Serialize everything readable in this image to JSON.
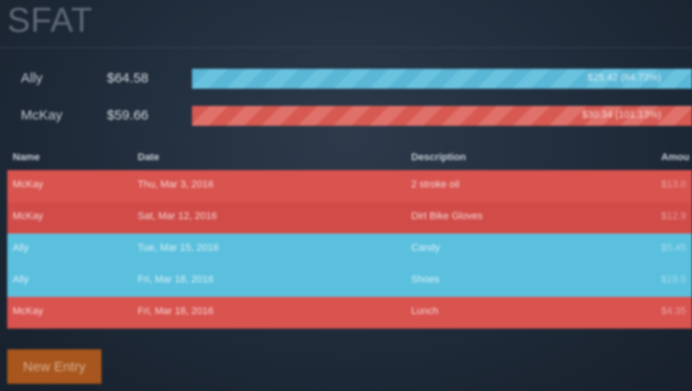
{
  "app": {
    "title": "SFAT"
  },
  "people": [
    {
      "name": "Ally",
      "total": "$64.58",
      "bar_label": "$25.42 (64.73%)",
      "bar_color": "#5bc0de"
    },
    {
      "name": "McKay",
      "total": "$59.66",
      "bar_label": "$30.34 (101.13%)",
      "bar_color": "#d9534f"
    }
  ],
  "table": {
    "headers": {
      "name": "Name",
      "date": "Date",
      "description": "Description",
      "amount": "Amou"
    },
    "rows": [
      {
        "name": "McKay",
        "date": "Thu, Mar 3, 2016",
        "description": "2 stroke oil",
        "amount": "$13.0",
        "color": "#d9534f"
      },
      {
        "name": "McKay",
        "date": "Sat, Mar 12, 2016",
        "description": "Dirt Bike Gloves",
        "amount": "$12.9",
        "color": "#d9534f"
      },
      {
        "name": "Ally",
        "date": "Tue, Mar 15, 2016",
        "description": "Candy",
        "amount": "$5.45",
        "color": "#5bc0de"
      },
      {
        "name": "Ally",
        "date": "Fri, Mar 18, 2016",
        "description": "Shoes",
        "amount": "$19.5",
        "color": "#5bc0de"
      },
      {
        "name": "McKay",
        "date": "Fri, Mar 18, 2016",
        "description": "Lunch",
        "amount": "$4.35",
        "color": "#d9534f"
      }
    ]
  },
  "actions": {
    "new_entry_label": "New Entry",
    "new_entry_color": "#a8561e"
  }
}
